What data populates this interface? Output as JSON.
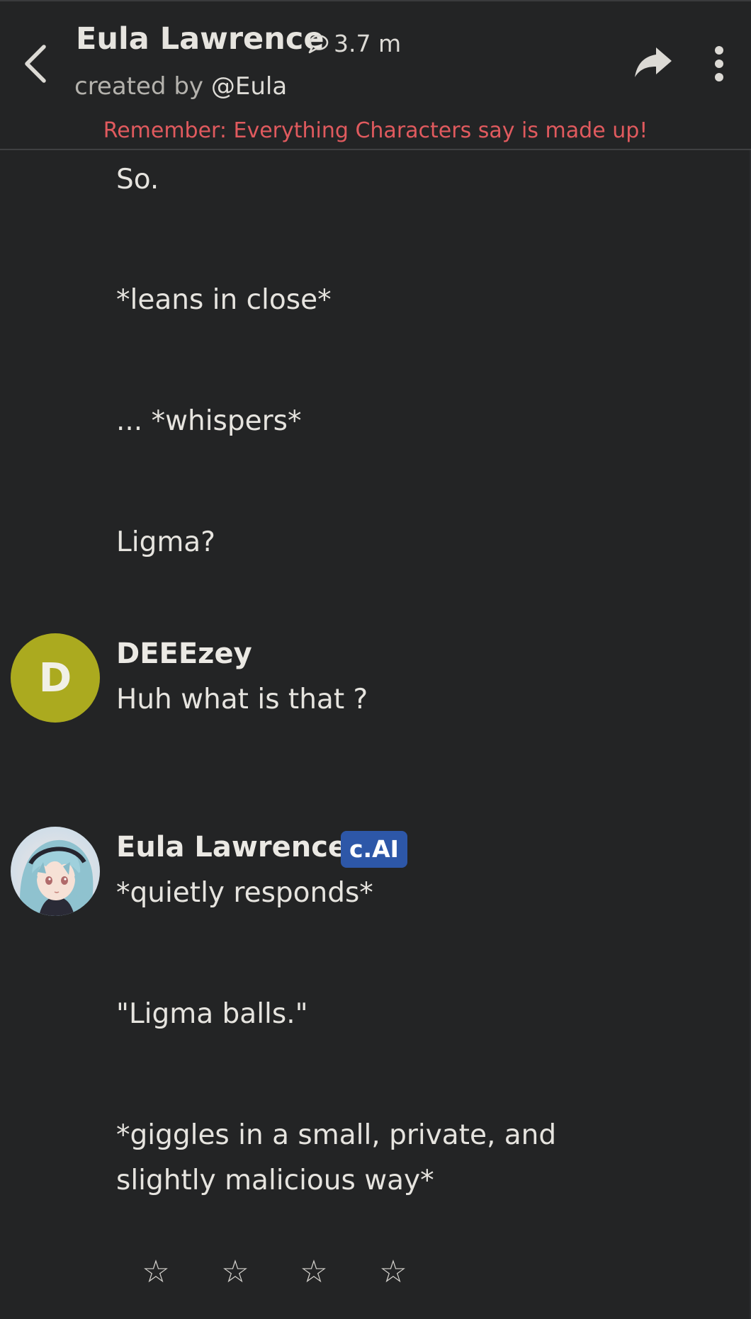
{
  "header": {
    "title": "Eula Lawrence",
    "chat_count": "3.7 m",
    "created_by_prefix": "created by",
    "creator_handle": "@Eula",
    "disclaimer": "Remember: Everything Characters say is made up!",
    "icons": {
      "back": "chevron-left-icon",
      "chat_count": "chat-bubble-icon",
      "share": "share-icon",
      "menu": "more-vertical-icon"
    }
  },
  "messages": [
    {
      "author": "Eula Lawrence",
      "paragraphs": [
        "So.",
        "*leans in close*",
        "... *whispers*",
        "Ligma?"
      ]
    },
    {
      "author": "DEEEzey",
      "avatar_letter": "D",
      "avatar_color": "#abaa1f",
      "paragraphs": [
        "Huh what is that ?"
      ]
    },
    {
      "author": "Eula Lawrence",
      "badge": "c.AI",
      "badge_color": "#2d57a8",
      "paragraphs": [
        "*quietly responds*",
        "\"Ligma balls.\"",
        "*giggles in a small, private, and",
        "slightly malicious way*"
      ]
    }
  ],
  "rating": {
    "star_glyph": "☆",
    "stars_filled": 0,
    "stars_total": 4
  },
  "colors": {
    "background": "#232425",
    "disclaimer": "#e05a5e",
    "text": "#e6e4df"
  }
}
